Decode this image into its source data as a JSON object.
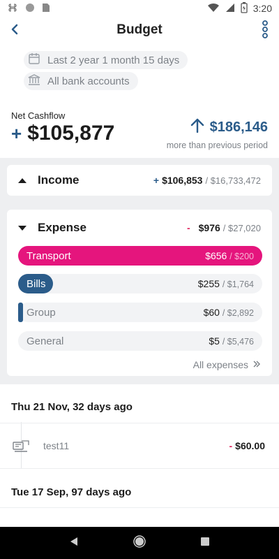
{
  "status_bar": {
    "time": "3:20"
  },
  "header": {
    "title": "Budget"
  },
  "filters": {
    "date_range": "Last 2 year 1 month 15 days",
    "accounts": "All bank accounts"
  },
  "summary": {
    "net_label": "Net Cashflow",
    "net_sign": "+",
    "net_value": "$105,877",
    "diff_value": "$186,146",
    "diff_note": "more than previous period"
  },
  "income": {
    "title": "Income",
    "sign": "+",
    "amount": "$106,853",
    "total": "/ $16,733,472"
  },
  "expense": {
    "title": "Expense",
    "sign": "-",
    "amount": "$976",
    "total": "/ $27,020",
    "categories": [
      {
        "name": "Transport",
        "amount": "$656",
        "budget": "/ $200",
        "progress": 1.0,
        "color": "#e5157d"
      },
      {
        "name": "Bills",
        "amount": "$255",
        "budget": "/ $1,764",
        "progress": 0.14,
        "color": "#2b5c8a"
      },
      {
        "name": "Group",
        "amount": "$60",
        "budget": "/ $2,892",
        "progress": 0.02,
        "color": "#2b5c8a"
      },
      {
        "name": "General",
        "amount": "$5",
        "budget": "/ $5,476",
        "progress": 0.0,
        "color": "#2b5c8a"
      }
    ],
    "all_link": "All expenses"
  },
  "transactions": {
    "groups": [
      {
        "date": "Thu 21 Nov, 32 days ago",
        "items": [
          {
            "name": "test11",
            "sign": "-",
            "amount": "$60.00",
            "icon": "bill-icon"
          }
        ]
      },
      {
        "date": "Tue 17 Sep, 97 days ago",
        "items": []
      }
    ]
  },
  "colors": {
    "accent": "#2b5c8a",
    "expense": "#e5157d",
    "negative": "#e0245e"
  }
}
